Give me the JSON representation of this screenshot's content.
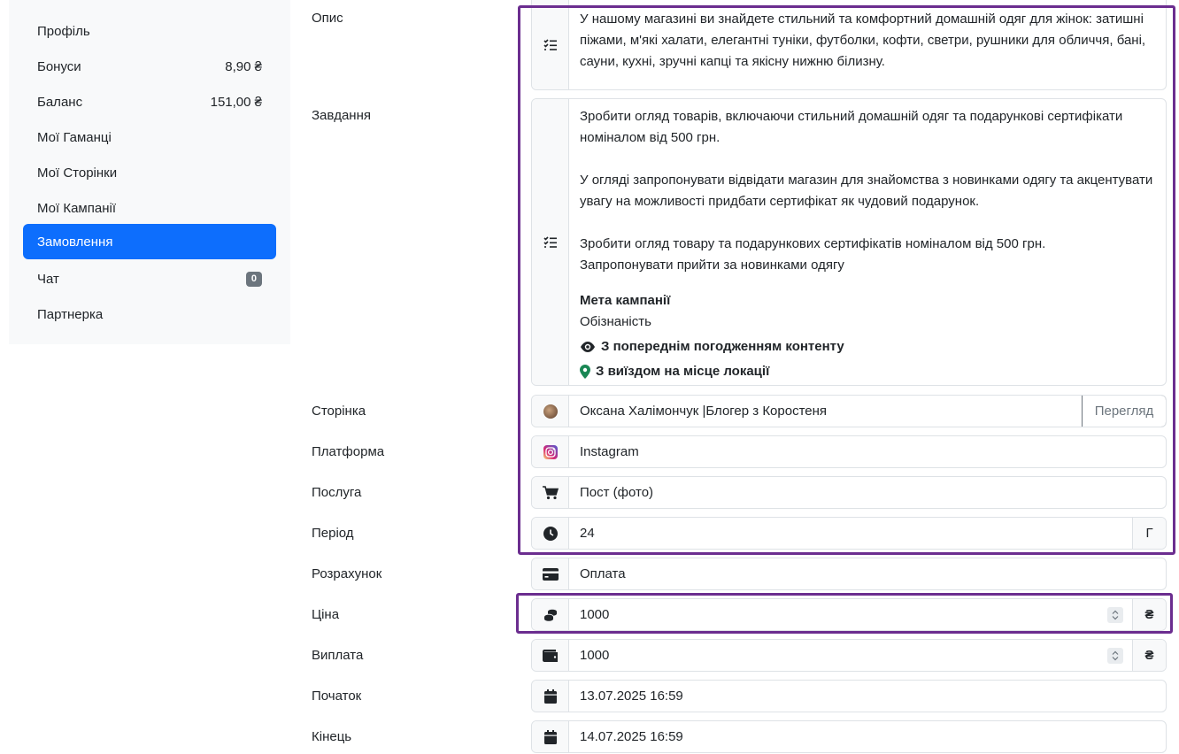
{
  "sidebar": {
    "items": [
      {
        "label": "Профіль",
        "value": ""
      },
      {
        "label": "Бонуси",
        "value": "8,90 ₴"
      },
      {
        "label": "Баланс",
        "value": "151,00 ₴"
      },
      {
        "label": "Мої Гаманці",
        "value": ""
      },
      {
        "label": "Мої Сторінки",
        "value": ""
      },
      {
        "label": "Мої Кампанії",
        "value": ""
      },
      {
        "label": "Замовлення",
        "value": ""
      },
      {
        "label": "Чат",
        "value": "0"
      },
      {
        "label": "Партнерка",
        "value": ""
      }
    ]
  },
  "form": {
    "description": {
      "label": "Опис",
      "text": "У нашому магазині ви знайдете стильний та комфортний домашній одяг для жінок: затишні піжами, м'які халати, елегантні туніки, футболки, кофти, светри, рушники для обличчя, бані, сауни, кухні, зручні капці та якісну нижню білизну."
    },
    "task": {
      "label": "Завдання",
      "p1": "Зробити огляд товарів, включаючи стильний домашній одяг та подарункові сертифікати номіналом від 500 грн.",
      "p2": "У огляді запропонувати відвідати магазин для знайомства з новинками одягу та акцентувати увагу на можливості придбати сертифікат як чудовий подарунок.",
      "p3a": "Зробити огляд товару та подарункових сертифікатів номіналом від 500 грн.",
      "p3b": "Запропонувати прийти за новинками одягу",
      "goal_title": "Мета кампанії",
      "goal_value": "Обізнаність",
      "approval": "З попереднім погодженням контенту",
      "location": "З виїздом на місце локації"
    },
    "page": {
      "label": "Сторінка",
      "value": "Оксана Халімончук |Блогер з Коростеня",
      "button": "Перегляд"
    },
    "platform": {
      "label": "Платформа",
      "value": "Instagram"
    },
    "service": {
      "label": "Послуга",
      "value": "Пост (фото)"
    },
    "period": {
      "label": "Період",
      "value": "24",
      "unit": "Г"
    },
    "settlement": {
      "label": "Розрахунок",
      "value": "Оплата"
    },
    "price": {
      "label": "Ціна",
      "value": "1000",
      "currency": "₴"
    },
    "payout": {
      "label": "Виплата",
      "value": "1000",
      "currency": "₴"
    },
    "start": {
      "label": "Початок",
      "value": "13.07.2025 16:59"
    },
    "end": {
      "label": "Кінець",
      "value": "14.07.2025 16:59"
    }
  },
  "colors": {
    "accent": "#0d6efd",
    "highlight": "#6b2d8f",
    "location_pin": "#198754"
  }
}
